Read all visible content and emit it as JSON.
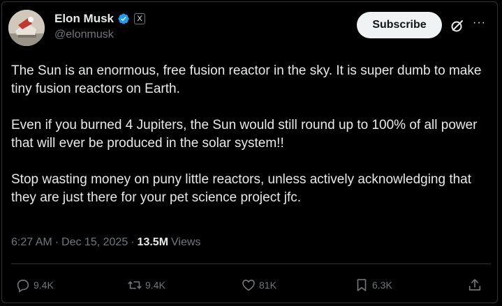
{
  "author": {
    "name": "Elon Musk",
    "handle": "@elonmusk",
    "badge_text": "X"
  },
  "header": {
    "subscribe_label": "Subscribe"
  },
  "post": {
    "paragraphs": [
      "The Sun is an enormous, free fusion reactor in the sky. It is super dumb to make tiny fusion reactors on Earth.",
      "Even if you burned 4 Jupiters, the Sun would still round up to 100% of all power that will ever be produced in the solar system!!",
      "Stop wasting money on puny little reactors, unless actively acknowledging that they are just there for your pet science project jfc."
    ]
  },
  "meta": {
    "time": "6:27 AM",
    "separator1": "·",
    "date": "Dec 15, 2025",
    "separator2": "·",
    "views_count": "13.5M",
    "views_label": "Views"
  },
  "actions": {
    "replies": "9.4K",
    "reposts": "9.4K",
    "likes": "81K",
    "bookmarks": "6.3K"
  },
  "icons": {
    "verified": "verified-badge-icon",
    "grok": "grok-icon",
    "more": "more-icon",
    "reply": "reply-icon",
    "repost": "repost-icon",
    "like": "heart-icon",
    "bookmark": "bookmark-icon",
    "share": "share-icon"
  },
  "colors": {
    "background": "#000000",
    "text": "#e7e9ea",
    "muted": "#71767b",
    "verified": "#1d9bf0",
    "subscribe_bg": "#eff3f4"
  }
}
